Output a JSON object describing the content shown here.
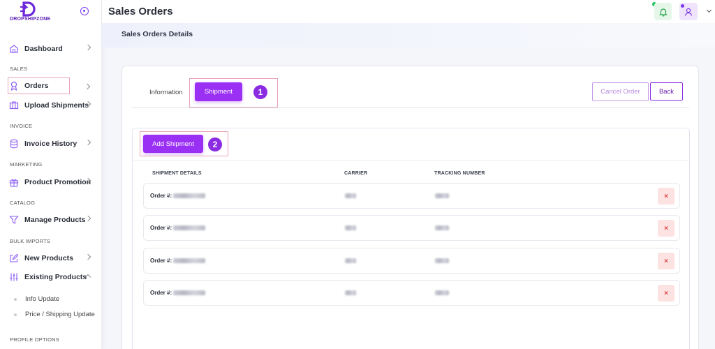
{
  "brand": {
    "name": "DROPSHIPZONE",
    "color": "#5b21b6"
  },
  "sidebar": {
    "dashboard": "Dashboard",
    "sections": {
      "sales": "SALES",
      "invoice": "INVOICE",
      "marketing": "MARKETING",
      "catalog": "CATALOG",
      "bulk_imports": "BULK IMPORTS",
      "profile_options": "PROFILE OPTIONS"
    },
    "items": {
      "orders": "Orders",
      "upload_shipments": "Upload Shipments",
      "invoice_history": "Invoice History",
      "product_promotion": "Product Promotion",
      "manage_products": "Manage Products",
      "new_products": "New Products",
      "existing_products": "Existing Products"
    },
    "sub_items": {
      "info_update": "Info Update",
      "price_shipping_update": "Price / Shipping Update"
    }
  },
  "header": {
    "title": "Sales Orders"
  },
  "banner": {
    "title": "Sales Orders Details"
  },
  "tabs": {
    "information": "Information",
    "shipment": "Shipment"
  },
  "actions": {
    "cancel_order": "Cancel Order",
    "back": "Back",
    "add_shipment": "Add Shipment"
  },
  "badges": {
    "one": "1",
    "two": "2"
  },
  "table": {
    "headers": {
      "details": "SHIPMENT DETAILS",
      "carrier": "CARRIER",
      "tracking": "TRACKING NUMBER"
    },
    "order_label": "Order #:",
    "delete_symbol": "×"
  },
  "colors": {
    "accent": "#9b30f5",
    "delete_bg": "#fde2e2",
    "delete_fg": "#e04545",
    "highlight": "#e9a4b8"
  }
}
